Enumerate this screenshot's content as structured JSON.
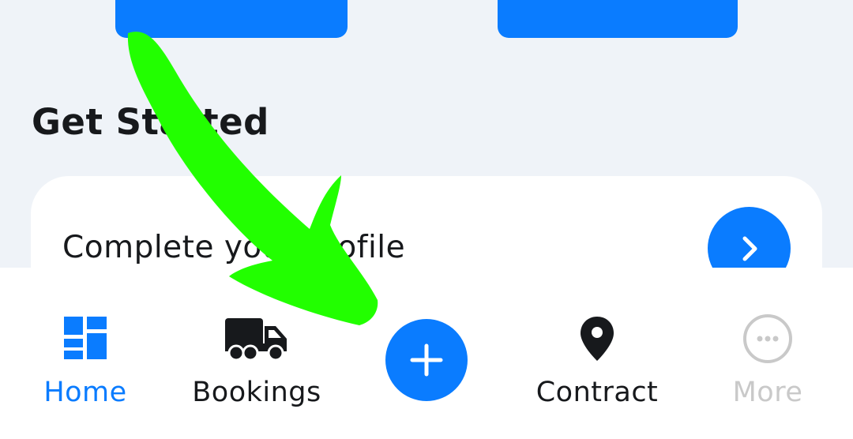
{
  "get_started": {
    "title": "Get Started",
    "profile_card": {
      "label": "Complete your profile"
    }
  },
  "tab_bar": {
    "tabs": [
      {
        "label": "Home",
        "icon": "dashboard-icon",
        "active": true
      },
      {
        "label": "Bookings",
        "icon": "truck-icon",
        "active": false
      },
      {
        "label": "Contract",
        "icon": "map-pin-icon",
        "active": false
      },
      {
        "label": "More",
        "icon": "more-icon",
        "active": false,
        "disabled": true
      }
    ],
    "add_button_icon": "plus-icon"
  },
  "colors": {
    "accent": "#0a7cff",
    "background": "#eff3f8",
    "text": "#17191c",
    "muted": "#c9c9c9",
    "annotation": "#22ff00"
  }
}
